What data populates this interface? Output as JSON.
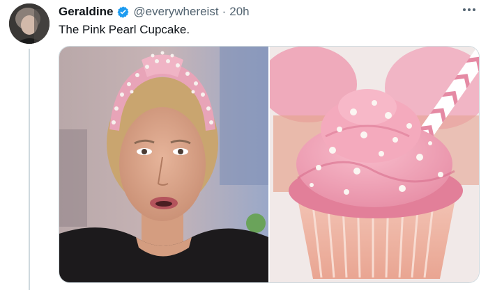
{
  "tweet": {
    "author_name": "Geraldine",
    "handle": "@everywhereist",
    "separator": "·",
    "time": "20h",
    "text": "The Pink Pearl Cupcake."
  },
  "icons": {
    "verified": "verified-badge-icon",
    "more": "more-options-icon"
  },
  "colors": {
    "verified_blue": "#1d9bf0",
    "text_primary": "#0f1419",
    "text_secondary": "#536471",
    "border": "#cfd9de"
  }
}
